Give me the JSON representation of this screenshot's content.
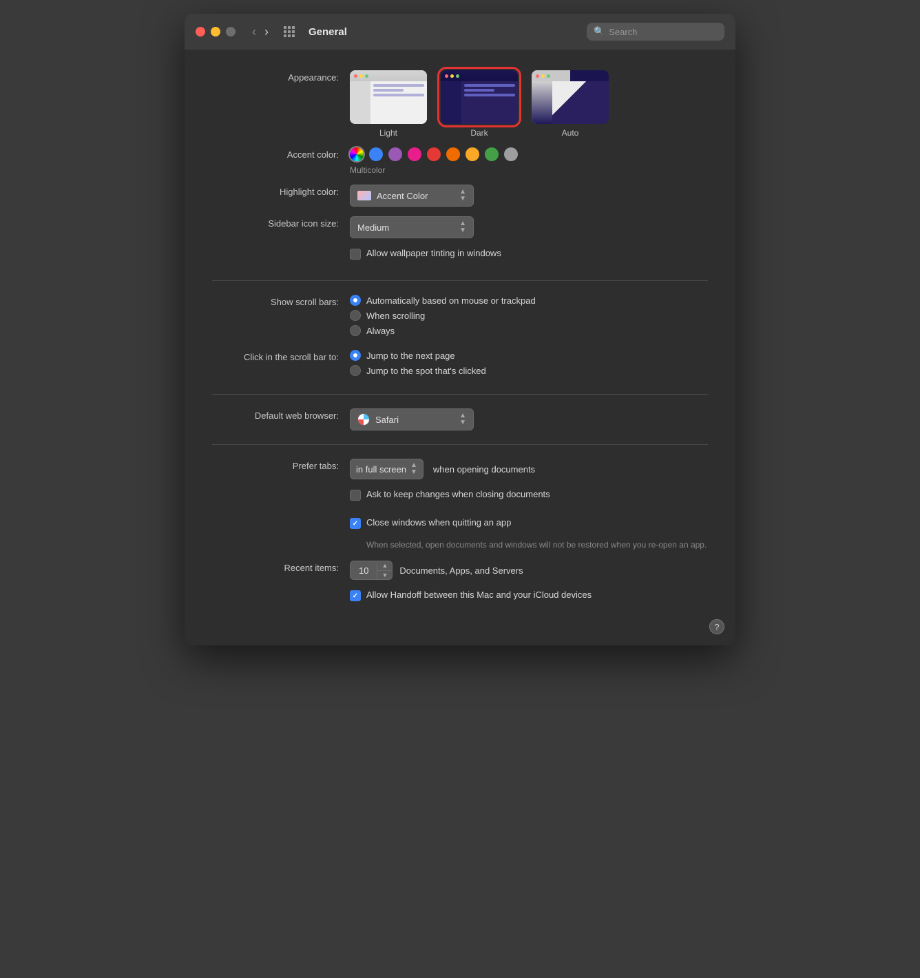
{
  "window": {
    "title": "General"
  },
  "titlebar": {
    "back_label": "‹",
    "forward_label": "›"
  },
  "search": {
    "placeholder": "Search"
  },
  "appearance": {
    "label": "Appearance:",
    "options": [
      {
        "id": "light",
        "label": "Light",
        "selected": false
      },
      {
        "id": "dark",
        "label": "Dark",
        "selected": true
      },
      {
        "id": "auto",
        "label": "Auto",
        "selected": false
      }
    ]
  },
  "accent_color": {
    "label": "Accent color:",
    "multicolor_label": "Multicolor",
    "colors": [
      {
        "name": "multicolor",
        "hex": "conic"
      },
      {
        "name": "blue",
        "hex": "#3b82f6"
      },
      {
        "name": "purple",
        "hex": "#9b59b6"
      },
      {
        "name": "pink",
        "hex": "#e91e8c"
      },
      {
        "name": "red",
        "hex": "#e53935"
      },
      {
        "name": "orange",
        "hex": "#ef6c00"
      },
      {
        "name": "yellow",
        "hex": "#f9a825"
      },
      {
        "name": "green",
        "hex": "#43a047"
      },
      {
        "name": "graphite",
        "hex": "#9e9e9e"
      }
    ]
  },
  "highlight_color": {
    "label": "Highlight color:",
    "value": "Accent Color"
  },
  "sidebar_icon_size": {
    "label": "Sidebar icon size:",
    "value": "Medium"
  },
  "wallpaper_tinting": {
    "label": "",
    "checkbox_label": "Allow wallpaper tinting in windows",
    "checked": false
  },
  "show_scroll_bars": {
    "label": "Show scroll bars:",
    "options": [
      {
        "id": "auto",
        "label": "Automatically based on mouse or trackpad",
        "selected": true
      },
      {
        "id": "scrolling",
        "label": "When scrolling",
        "selected": false
      },
      {
        "id": "always",
        "label": "Always",
        "selected": false
      }
    ]
  },
  "click_scroll_bar": {
    "label": "Click in the scroll bar to:",
    "options": [
      {
        "id": "next_page",
        "label": "Jump to the next page",
        "selected": true
      },
      {
        "id": "spot",
        "label": "Jump to the spot that's clicked",
        "selected": false
      }
    ]
  },
  "default_browser": {
    "label": "Default web browser:",
    "value": "Safari"
  },
  "prefer_tabs": {
    "label": "Prefer tabs:",
    "dropdown_value": "in full screen",
    "after_text": "when opening documents"
  },
  "ask_keep_changes": {
    "label": "Ask to keep changes when closing documents",
    "checked": false
  },
  "close_windows": {
    "label": "Close windows when quitting an app",
    "checked": true,
    "sub_text": "When selected, open documents and windows will not be restored when you re-open an app."
  },
  "recent_items": {
    "label": "Recent items:",
    "value": "10",
    "after_text": "Documents, Apps, and Servers"
  },
  "handoff": {
    "label": "Allow Handoff between this Mac and your iCloud devices",
    "checked": true
  },
  "help": {
    "label": "?"
  }
}
